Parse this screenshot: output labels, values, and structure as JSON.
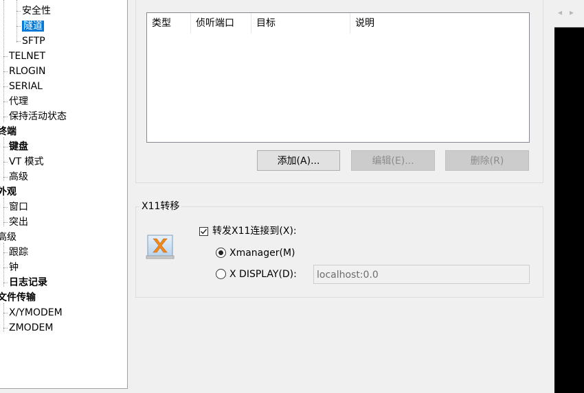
{
  "tree": {
    "items": [
      {
        "label": "安全性",
        "depth": 2,
        "bold": false,
        "selected": false
      },
      {
        "label": "隧道",
        "depth": 2,
        "bold": false,
        "selected": true
      },
      {
        "label": "SFTP",
        "depth": 2,
        "bold": false,
        "selected": false
      },
      {
        "label": "TELNET",
        "depth": 1,
        "bold": false,
        "selected": false
      },
      {
        "label": "RLOGIN",
        "depth": 1,
        "bold": false,
        "selected": false
      },
      {
        "label": "SERIAL",
        "depth": 1,
        "bold": false,
        "selected": false
      },
      {
        "label": "代理",
        "depth": 1,
        "bold": false,
        "selected": false
      },
      {
        "label": "保持活动状态",
        "depth": 1,
        "bold": false,
        "selected": false
      },
      {
        "label": "终端",
        "depth": 0,
        "bold": true,
        "selected": false
      },
      {
        "label": "键盘",
        "depth": 1,
        "bold": true,
        "selected": false
      },
      {
        "label": "VT 模式",
        "depth": 1,
        "bold": false,
        "selected": false
      },
      {
        "label": "高级",
        "depth": 1,
        "bold": false,
        "selected": false
      },
      {
        "label": "外观",
        "depth": 0,
        "bold": true,
        "selected": false
      },
      {
        "label": "窗口",
        "depth": 1,
        "bold": false,
        "selected": false
      },
      {
        "label": "突出",
        "depth": 1,
        "bold": false,
        "selected": false
      },
      {
        "label": "高级",
        "depth": 0,
        "bold": false,
        "selected": false
      },
      {
        "label": "跟踪",
        "depth": 1,
        "bold": false,
        "selected": false
      },
      {
        "label": "钟",
        "depth": 1,
        "bold": false,
        "selected": false
      },
      {
        "label": "日志记录",
        "depth": 1,
        "bold": true,
        "selected": false
      },
      {
        "label": "文件传输",
        "depth": 0,
        "bold": true,
        "selected": false
      },
      {
        "label": "X/YMODEM",
        "depth": 1,
        "bold": false,
        "selected": false
      },
      {
        "label": "ZMODEM",
        "depth": 1,
        "bold": false,
        "selected": false
      }
    ]
  },
  "tunnel": {
    "columns": [
      "类型",
      "侦听端口",
      "目标",
      "说明"
    ],
    "rows": [],
    "add_label": "添加(A)...",
    "edit_label": "编辑(E)...",
    "delete_label": "删除(R)"
  },
  "x11": {
    "group_title": "X11转移",
    "forward_label": "转发X11连接到(X):",
    "forward_checked": true,
    "xmanager_label": "Xmanager(M)",
    "display_label": "X DISPLAY(D):",
    "selected_option": "xmanager",
    "display_value": "localhost:0.0"
  },
  "icons": {
    "x11": "xmanager-icon",
    "tab_left": "tab-scroll-left-icon",
    "tab_right": "tab-scroll-right-icon"
  },
  "colors": {
    "selection": "#0078d7",
    "dialog_bg": "#f0f0f0"
  }
}
